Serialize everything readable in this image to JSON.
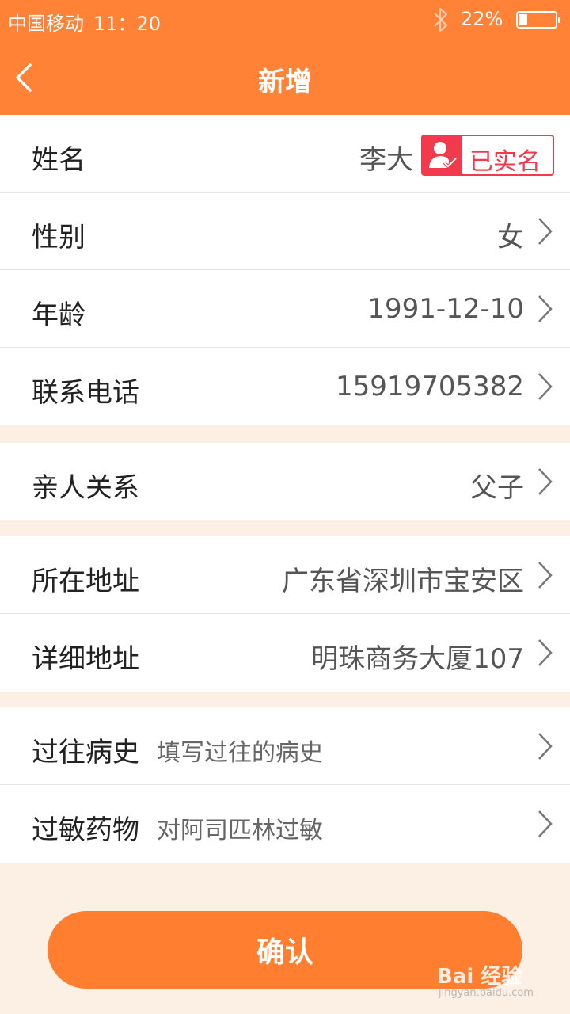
{
  "status_bar": {
    "carrier": "中国移动",
    "time": "11：20",
    "battery_percent": "22%",
    "battery_level": 0.22,
    "bluetooth_icon": "bluetooth-icon"
  },
  "header": {
    "title": "新增",
    "back_icon": "chevron-left-icon"
  },
  "colors": {
    "accent": "#ff8237",
    "verified_red": "#f23a4d",
    "background": "#fbf0e3"
  },
  "basic_info": {
    "name": {
      "label": "姓名",
      "value": "李大",
      "badge": "已实名",
      "badge_icon": "verified-user-icon"
    },
    "gender": {
      "label": "性别",
      "value": "女"
    },
    "age": {
      "label": "年龄",
      "value": "1991-12-10"
    },
    "phone": {
      "label": "联系电话",
      "value": "15919705382"
    }
  },
  "relation": {
    "label": "亲人关系",
    "value": "父子"
  },
  "address": {
    "region": {
      "label": "所在地址",
      "value": "广东省深圳市宝安区"
    },
    "detail": {
      "label": "详细地址",
      "value": "明珠商务大厦107"
    }
  },
  "medical": {
    "history": {
      "label": "过往病史",
      "placeholder": "填写过往的病史"
    },
    "allergy": {
      "label": "过敏药物",
      "value": "对阿司匹林过敏"
    }
  },
  "confirm_label": "确认",
  "watermark": {
    "text": "Bai 经验",
    "sub": "jingyan.baidu.com"
  }
}
